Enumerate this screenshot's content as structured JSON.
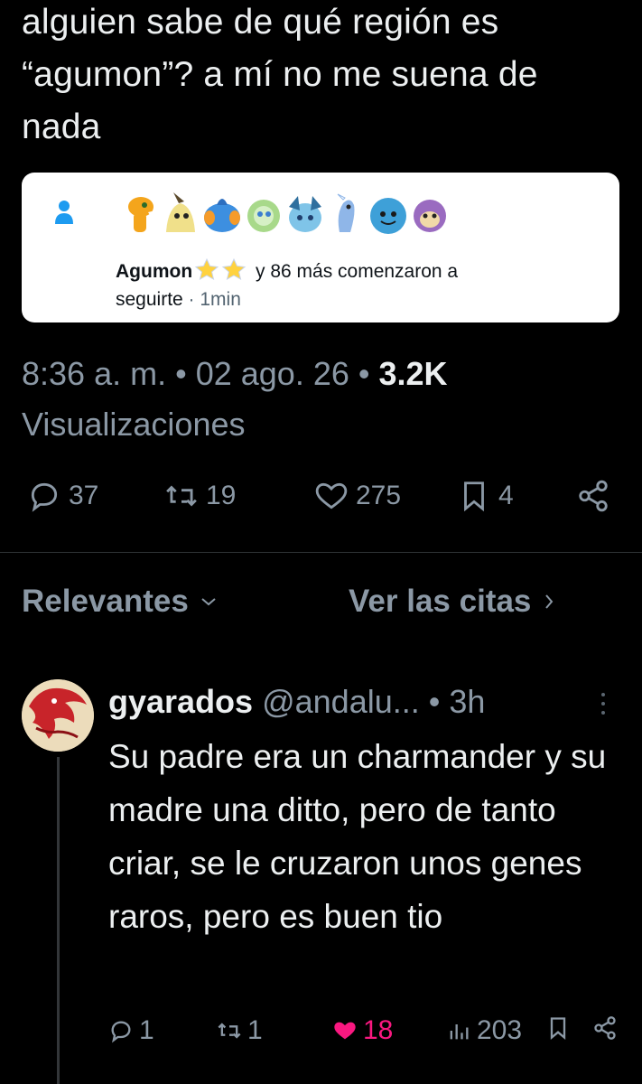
{
  "tweet": {
    "text": "alguien sabe de qué región es “agumon”? a mí no me suena de nada",
    "notification": {
      "name": "Agumon",
      "rest": " y 86 más comenzaron a ",
      "rest2": "seguirte",
      "time": " · 1min"
    },
    "time": "8:36 a. m.",
    "date": "02 ago. 26",
    "views_count": "3.2K",
    "views_label": "Visualizaciones",
    "actions": {
      "replies": "37",
      "reposts": "19",
      "likes": "275",
      "bookmarks": "4"
    }
  },
  "tabs": {
    "relevant": "Relevantes",
    "quotes": "Ver las citas"
  },
  "reply": {
    "name": "gyarados",
    "handle": "@andalu...",
    "time": "3h",
    "text": "Su padre era un charmander y su madre una ditto, pero de tanto criar, se le cruzaron unos genes raros, pero es buen tio",
    "actions": {
      "replies": "1",
      "reposts": "1",
      "likes": "18",
      "views": "203"
    }
  },
  "colors": {
    "background": "#000000",
    "muted": "#8b98a5",
    "like": "#f91880",
    "card": "#ffffff"
  }
}
